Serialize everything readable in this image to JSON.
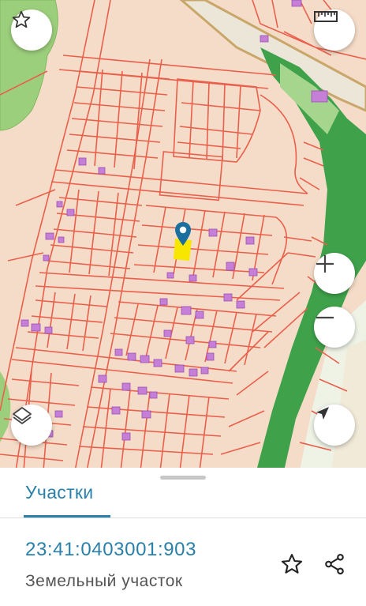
{
  "map": {
    "marker_icon": "location-pin-icon",
    "colors": {
      "background": "#f5dcc8",
      "parcel_border": "#e8604c",
      "green_area": "#4caf50",
      "light_green": "#a6d58e",
      "building": "#c67fd6",
      "selected_parcel": "#f6e600",
      "marker": "#1a6fa0"
    }
  },
  "controls": {
    "favorite_icon": "star-icon",
    "ruler_icon": "ruler-icon",
    "zoom_in_icon": "plus-icon",
    "zoom_out_icon": "minus-icon",
    "layers_icon": "layers-icon",
    "location_icon": "navigation-arrow-icon"
  },
  "sheet": {
    "tab_label": "Участки",
    "parcel_number": "23:41:0403001:903",
    "parcel_type": "Земельный участок",
    "favorite_icon": "star-outline-icon",
    "share_icon": "share-icon",
    "accent_color": "#2a80a8"
  }
}
